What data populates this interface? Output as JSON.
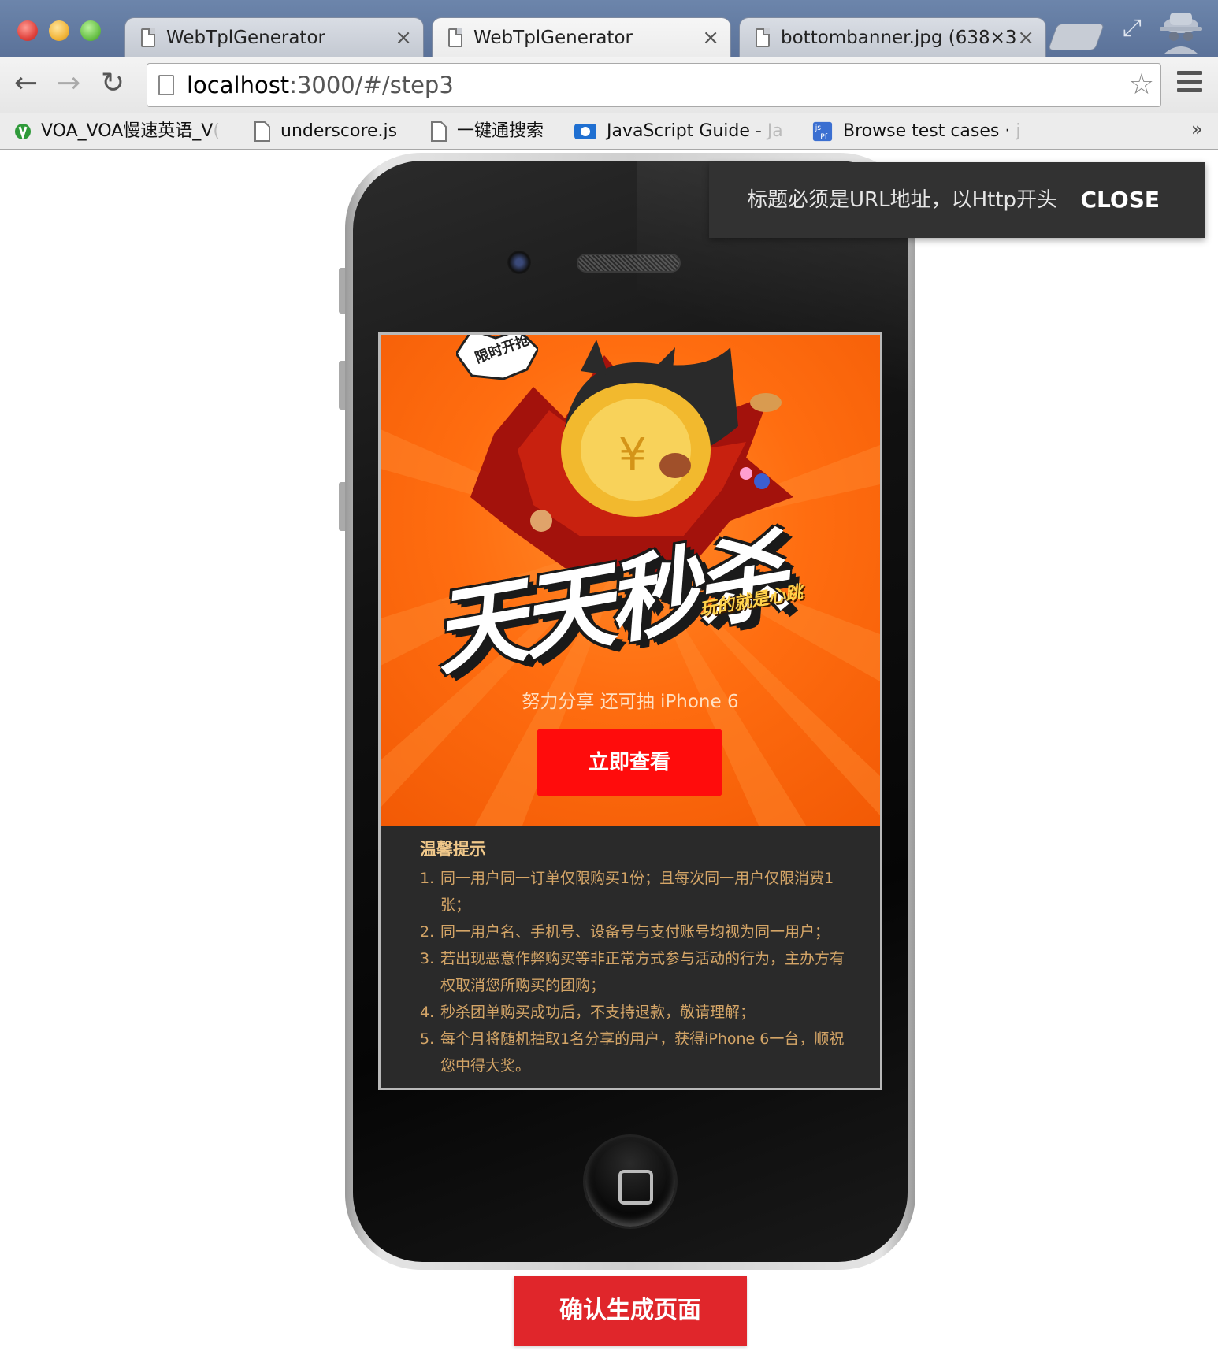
{
  "browser": {
    "tabs": [
      {
        "title": "WebTplGenerator",
        "close": "×",
        "active": false
      },
      {
        "title": "WebTplGenerator",
        "close": "×",
        "active": true
      },
      {
        "title": "bottombanner.jpg (638×3",
        "close": "×",
        "active": false
      }
    ],
    "url_host": "localhost",
    "url_path": ":3000/#/step3",
    "bookmarks": [
      {
        "label": "VOA_VOA慢速英语_V",
        "fade": "(",
        "icon": "voa-icon"
      },
      {
        "label": "underscore.js",
        "fade": "",
        "icon": "page-icon"
      },
      {
        "label": "一键通搜索",
        "fade": "",
        "icon": "page-icon"
      },
      {
        "label": "JavaScript Guide - ",
        "fade": "Ja",
        "icon": "mdn-icon"
      },
      {
        "label": "Browse test cases · ",
        "fade": "j",
        "icon": "jsperf-icon"
      }
    ],
    "bookmarks_more": "»"
  },
  "toast": {
    "message": "标题必须是URL地址，以Http开头",
    "close_label": "CLOSE"
  },
  "banner": {
    "badge": "限时开抢",
    "title": "天天秒杀",
    "slogan": "玩的就是心跳",
    "subtitle": "努力分享 还可抽 iPhone 6",
    "cta_label": "立即查看",
    "colors": {
      "background": "#ff6d10",
      "cta": "#ff0c0c"
    }
  },
  "tips": {
    "title": "温馨提示",
    "items": [
      {
        "num": "1.",
        "text": "同一用户同一订单仅限购买1份；且每次同一用户仅限消费1张；"
      },
      {
        "num": "2.",
        "text": "同一用户名、手机号、设备号与支付账号均视为同一用户；"
      },
      {
        "num": "3.",
        "text": "若出现恶意作弊购买等非正常方式参与活动的行为，主办方有权取消您所购买的团购；"
      },
      {
        "num": "4.",
        "text": "秒杀团单购买成功后，不支持退款，敬请理解；"
      },
      {
        "num": "5.",
        "text": "每个月将随机抽取1名分享的用户，获得iPhone 6一台，顺祝您中得大奖。"
      }
    ]
  },
  "confirm_label": "确认生成页面",
  "colors": {
    "confirm": "#e0262b",
    "toast_bg": "#323232"
  }
}
